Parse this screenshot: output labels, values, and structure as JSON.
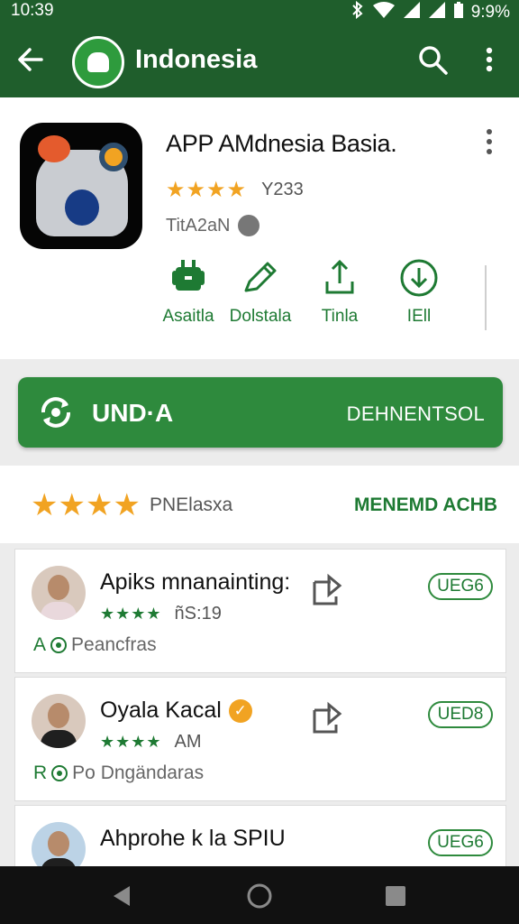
{
  "status_bar": {
    "time": "10:39",
    "battery": "9:9%"
  },
  "app_bar": {
    "title": "Indonesia",
    "back_icon": "arrow-back-icon",
    "search_icon": "search-icon",
    "more_icon": "more-vert-icon"
  },
  "app": {
    "name": "APP AMdnesia   Basia.",
    "rating_stars": "★★★★",
    "rating_value": 3.5,
    "rating_count": "Y233",
    "developer": "TitA2aN",
    "actions": [
      {
        "label": "Asaitla",
        "icon": "android-share-icon"
      },
      {
        "label": "Dolstala",
        "icon": "pencil-icon"
      },
      {
        "label": "Tinla",
        "icon": "upload-icon"
      },
      {
        "label": "IEll",
        "icon": "download-icon"
      }
    ]
  },
  "cta": {
    "left_label": "UND·A",
    "right_label": "DEHNENTSOL",
    "icon": "sync-icon"
  },
  "reviews_header": {
    "stars": "★★★★",
    "label": "PNElasxa",
    "link": "MENEMD ACHB"
  },
  "reviews": [
    {
      "title": "Apiks mnanainting:",
      "stars": "★★★★",
      "when": "ñS:19",
      "footer_mark": "A",
      "footer_text": "Peancfras",
      "pill": "UEG6",
      "verified": false
    },
    {
      "title": "Oyala Kacal",
      "stars": "★★★★",
      "when": "AM",
      "footer_mark": "R",
      "footer_text": "Po Dngändaras",
      "pill": "UED8",
      "verified": true
    },
    {
      "title": "Ahprohe k la SPIU",
      "stars": "",
      "when": "",
      "footer_mark": "",
      "footer_text": "",
      "pill": "UEG6",
      "verified": false
    }
  ],
  "nav": {
    "back": "triangle-back-icon",
    "home": "circle-home-icon",
    "recents": "square-recents-icon"
  },
  "colors": {
    "primary_dark": "#1f5e2c",
    "primary": "#2e8a3d",
    "accent": "#f1a322",
    "text": "#111111"
  }
}
